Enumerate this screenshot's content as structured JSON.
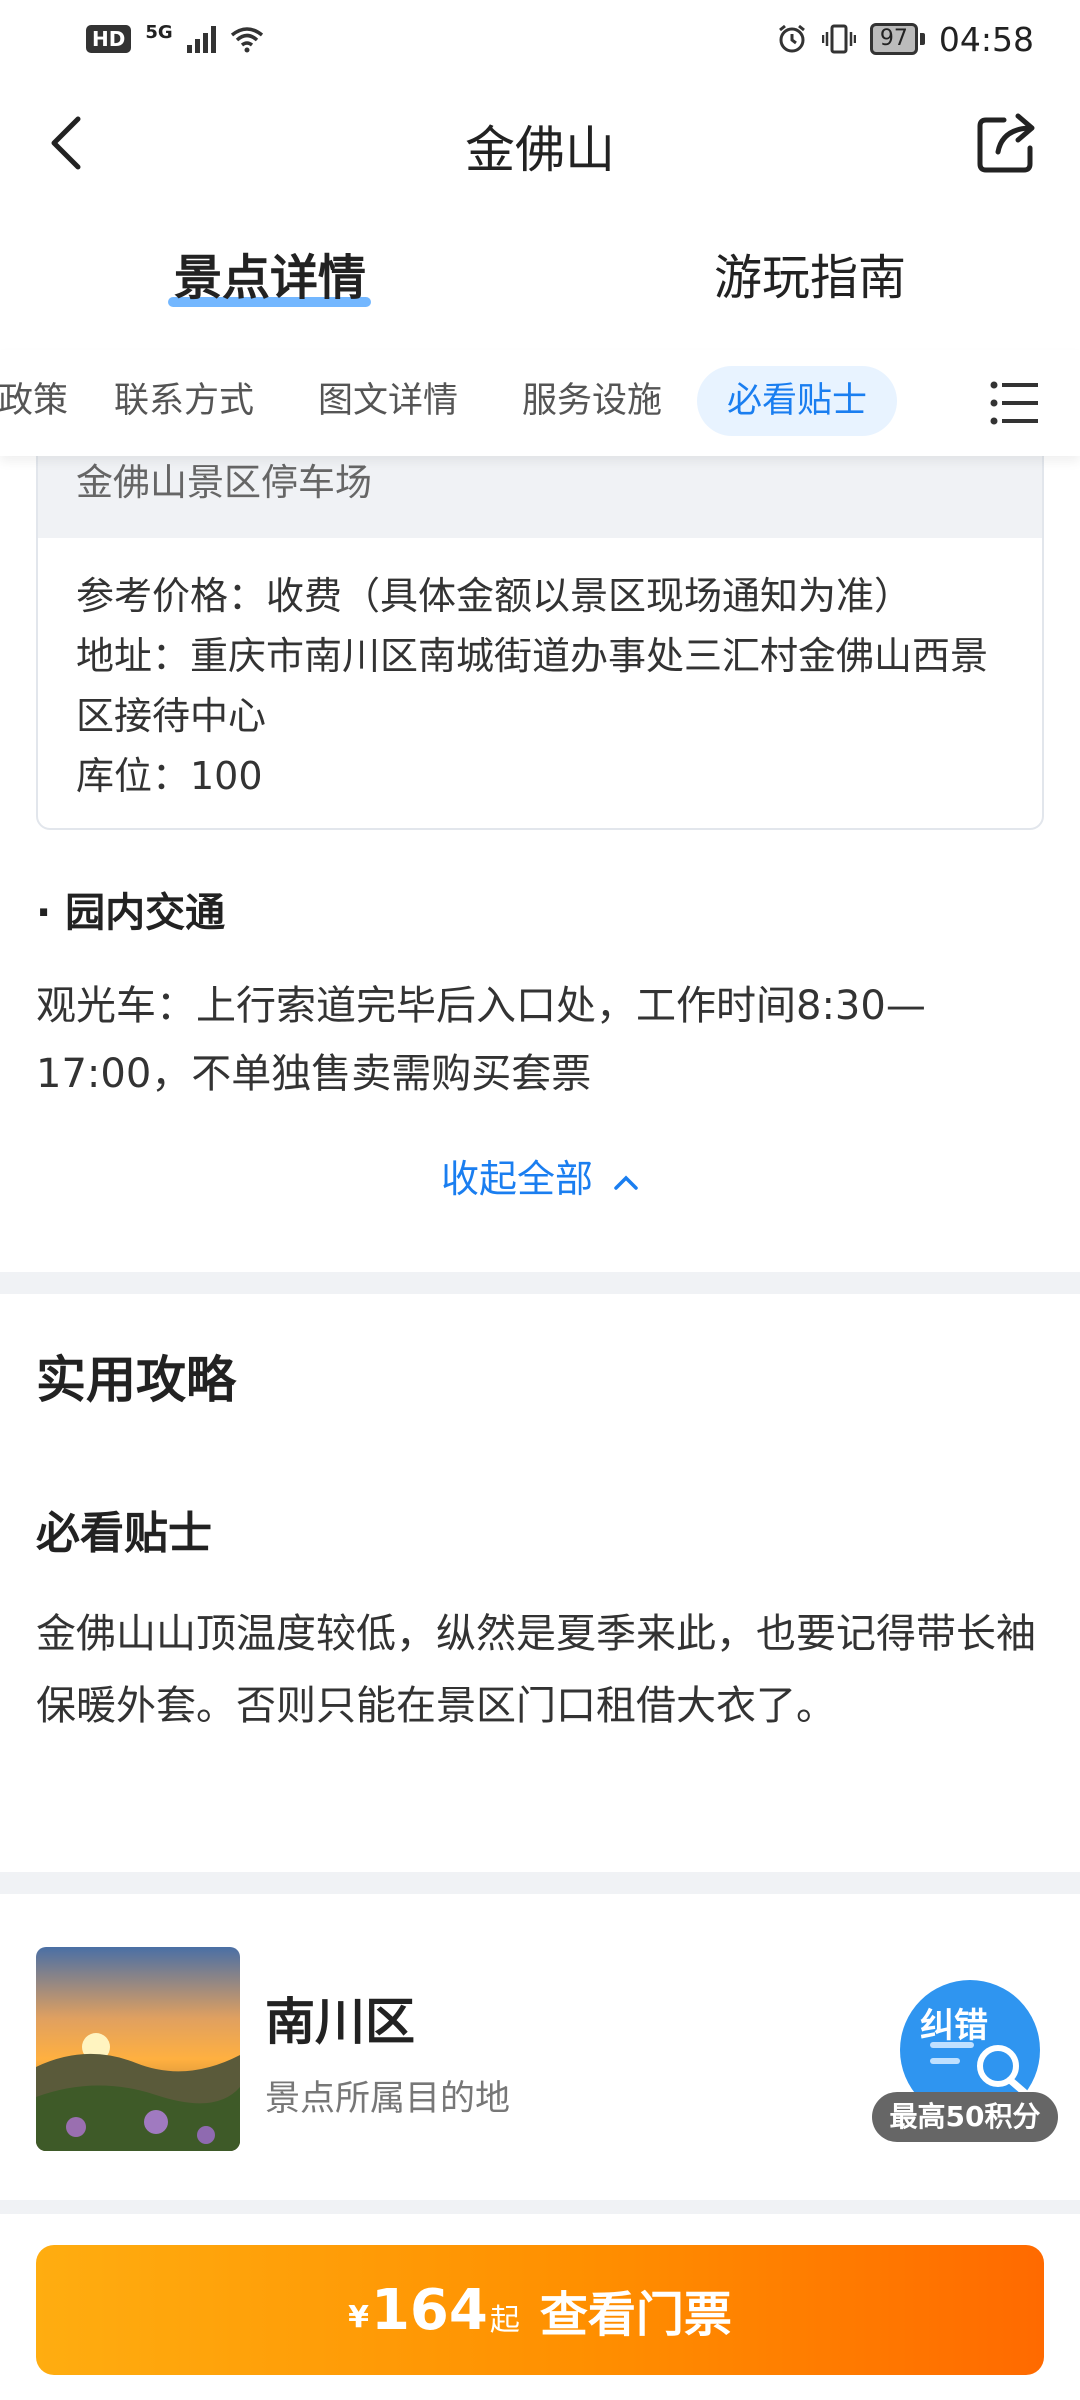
{
  "status_bar": {
    "hd": "HD",
    "network": "5G",
    "battery": "97",
    "time": "04:58"
  },
  "header": {
    "title": "金佛山",
    "back_icon": "back-arrow-icon",
    "share_icon": "share-icon"
  },
  "main_tabs": [
    {
      "label": "景点详情",
      "active": true
    },
    {
      "label": "游玩指南",
      "active": false
    }
  ],
  "sub_tabs": [
    {
      "label": "政策",
      "active": false
    },
    {
      "label": "联系方式",
      "active": false
    },
    {
      "label": "图文详情",
      "active": false
    },
    {
      "label": "服务设施",
      "active": false
    },
    {
      "label": "必看贴士",
      "active": true
    }
  ],
  "parking": {
    "name": "金佛山景区停车场",
    "lines": [
      "参考价格：收费（具体金额以景区现场通知为准）",
      "地址：重庆市南川区南城街道办事处三汇村金佛山西景区接待中心",
      "库位：100"
    ]
  },
  "transport": {
    "heading": "· 园内交通",
    "text": "观光车：上行索道完毕后入口处，工作时间8:30—17:00，不单独售卖需购买套票"
  },
  "collapse_label": "收起全部",
  "guide": {
    "title": "实用攻略",
    "tips_title": "必看贴士",
    "tips_text": "金佛山山顶温度较低，纵然是夏季来此，也要记得带长袖保暖外套。否则只能在景区门口租借大衣了。"
  },
  "destination": {
    "name": "南川区",
    "subtitle": "景点所属目的地"
  },
  "feedback": {
    "label": "纠错",
    "points": "最高50积分"
  },
  "ticket": {
    "currency": "¥",
    "price": "164",
    "suffix": "起",
    "label": "查看门票"
  },
  "colors": {
    "accent_blue": "#1a7ef0",
    "orange_start": "#ffad10",
    "orange_end": "#ff6a00"
  }
}
